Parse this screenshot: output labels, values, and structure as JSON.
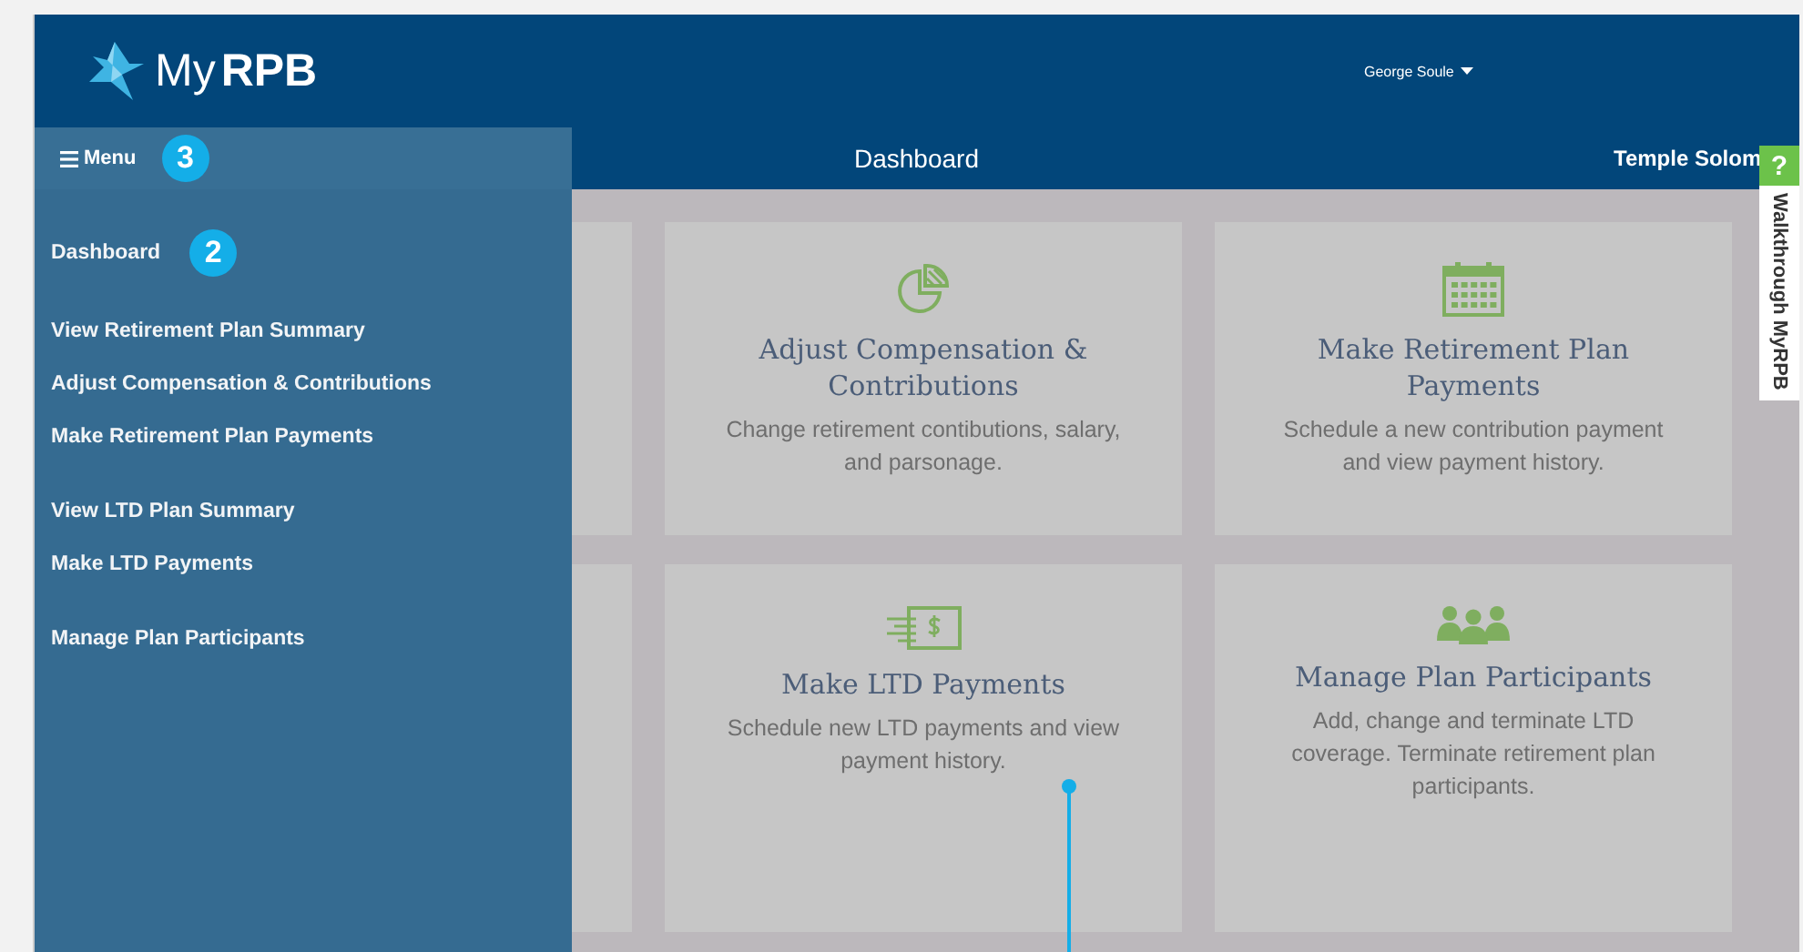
{
  "header": {
    "logo_light": "My",
    "logo_bold": "RPB",
    "user": "George Soule"
  },
  "nav": {
    "menu_label": "Menu",
    "menu_callout": "3",
    "title": "Dashboard",
    "organization": "Temple Solom"
  },
  "sidebar": {
    "groups": [
      [
        {
          "label": "Dashboard",
          "callout": "2"
        }
      ],
      [
        {
          "label": "View Retirement Plan Summary"
        },
        {
          "label": "Adjust Compensation & Contributions"
        },
        {
          "label": "Make Retirement Plan Payments"
        }
      ],
      [
        {
          "label": "View LTD Plan Summary"
        },
        {
          "label": "Make LTD Payments"
        }
      ],
      [
        {
          "label": "Manage Plan Participants"
        }
      ]
    ]
  },
  "cards": [
    {
      "kind": "pie",
      "title": "Adjust Compensation & Contributions",
      "text": "Change retirement contibutions, salary, and parsonage.",
      "marker": false
    },
    {
      "kind": "calendar",
      "title": "Make Retirement Plan Payments",
      "text": "Schedule a new contribution payment and view payment history.",
      "marker": false
    },
    {
      "kind": "money",
      "title": "Make LTD Payments",
      "text": "Schedule new LTD payments and view payment history.",
      "marker": true
    },
    {
      "kind": "people",
      "title": "Manage Plan Participants",
      "text": "Add, change and terminate LTD coverage. Terminate retirement plan participants.",
      "marker": false
    }
  ],
  "help_tab": {
    "icon": "?",
    "label": "Walkthrough MyRPB"
  }
}
